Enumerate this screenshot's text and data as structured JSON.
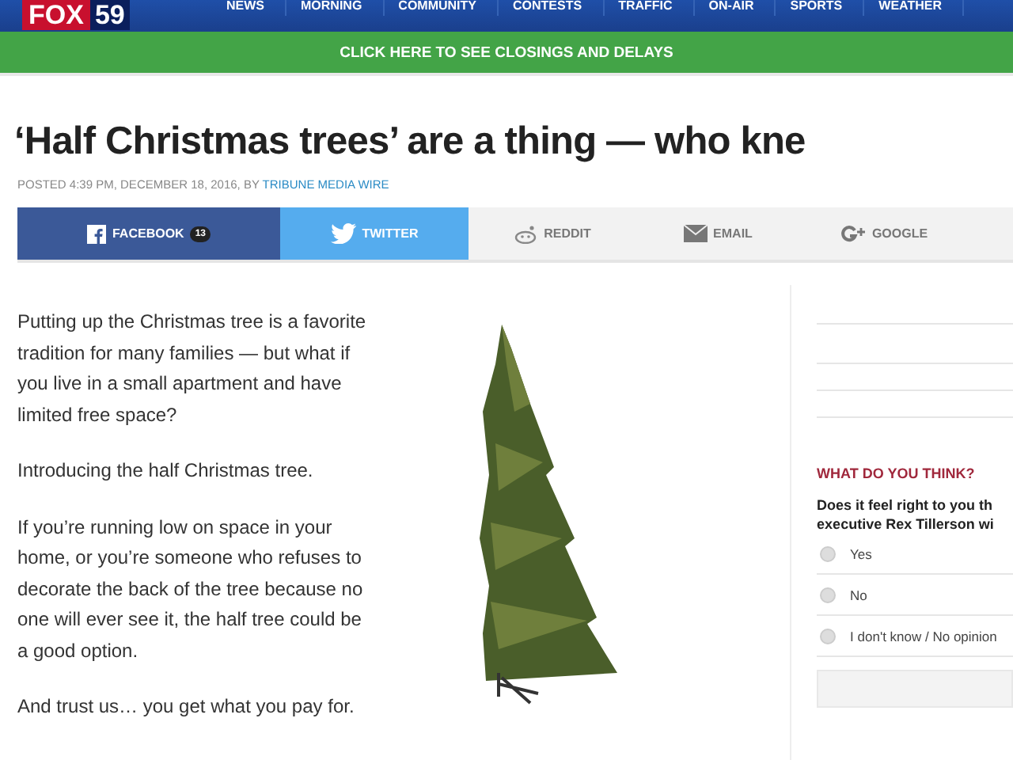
{
  "header": {
    "logo": {
      "brand": "FOX",
      "number": "59"
    },
    "nav": [
      "NEWS",
      "MORNING",
      "COMMUNITY",
      "CONTESTS",
      "TRAFFIC",
      "ON-AIR",
      "SPORTS",
      "WEATHER"
    ]
  },
  "alert_bar": {
    "label": "CLICK HERE TO SEE CLOSINGS AND DELAYS"
  },
  "article": {
    "headline": "‘Half Christmas trees’ are a thing — who kne",
    "byline": "POSTED 4:39 PM, DECEMBER 18, 2016, BY",
    "author": "TRIBUNE MEDIA WIRE",
    "share": [
      {
        "kind": "facebook",
        "label": "FACEBOOK",
        "count": "13"
      },
      {
        "kind": "twitter",
        "label": "TWITTER"
      },
      {
        "kind": "reddit",
        "label": "REDDIT"
      },
      {
        "kind": "email",
        "label": "EMAIL"
      },
      {
        "kind": "google",
        "label": "GOOGLE"
      }
    ],
    "paragraphs": [
      "Putting up the Christmas tree is a favorite tradition for many families — but what if you live in a small apartment and have limited free space?",
      "Introducing the half Christmas tree.",
      "If you’re running low on space in your home, or you’re someone who refuses to decorate the back of the tree because no one will ever see it, the half tree could be a good option.",
      "And trust us… you get what you pay for."
    ]
  },
  "poll": {
    "heading": "WHAT DO YOU THINK?",
    "question_lines": [
      "Does it feel right to you th",
      "executive Rex Tillerson wi"
    ],
    "options": [
      {
        "label": "Yes",
        "selected": false
      },
      {
        "label": "No",
        "selected": false
      },
      {
        "label": "I don't know / No opinion",
        "selected": false
      }
    ]
  }
}
